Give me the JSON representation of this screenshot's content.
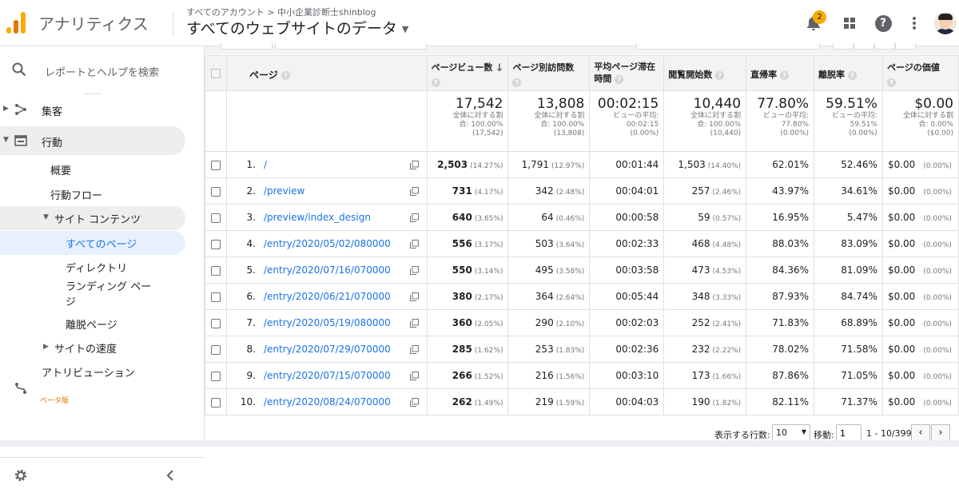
{
  "header": {
    "app_name": "アナリティクス",
    "breadcrumb": "すべてのアカウント > 中小企業診断士shinblog",
    "property_title": "すべてのウェブサイトのデータ",
    "notification_count": "2",
    "help_glyph": "?"
  },
  "sidebar": {
    "search_label": "レポートとヘルプを検索",
    "items": [
      {
        "label": "集客",
        "icon": "acquisition-icon"
      },
      {
        "label": "行動",
        "icon": "behavior-icon"
      },
      {
        "label": "概要"
      },
      {
        "label": "行動フロー"
      },
      {
        "label": "サイト コンテンツ"
      },
      {
        "label": "すべてのページ"
      },
      {
        "label": "ディレクトリ"
      },
      {
        "label": "ランディング ページ"
      },
      {
        "label": "離脱ページ"
      },
      {
        "label": "サイトの速度"
      },
      {
        "label": "アトリビューション",
        "icon": "attribution-icon"
      }
    ],
    "beta_label": "ベータ版"
  },
  "table": {
    "columns": {
      "page": "ページ",
      "pageviews": "ページビュー数",
      "unique": "ページ別訪問数",
      "avg_time": "平均ページ滞在時間",
      "entrances": "閲覧開始数",
      "bounce": "直帰率",
      "exit": "離脱率",
      "value": "ページの価値"
    },
    "totals": {
      "pageviews": {
        "value": "17,542",
        "sub1": "全体に対する割",
        "sub2": "合: 100.00%",
        "sub3": "(17,542)"
      },
      "unique": {
        "value": "13,808",
        "sub1": "全体に対する割",
        "sub2": "合: 100.00%",
        "sub3": "(13,808)"
      },
      "avg_time": {
        "value": "00:02:15",
        "sub1": "ビューの平均:",
        "sub2": "00:02:15",
        "sub3": "(0.00%)"
      },
      "entrances": {
        "value": "10,440",
        "sub1": "全体に対する割",
        "sub2": "合: 100.00%",
        "sub3": "(10,440)"
      },
      "bounce": {
        "value": "77.80%",
        "sub1": "ビューの平均:",
        "sub2": "77.80%",
        "sub3": "(0.00%)"
      },
      "exit": {
        "value": "59.51%",
        "sub1": "ビューの平均:",
        "sub2": "59.51%",
        "sub3": "(0.00%)"
      },
      "value": {
        "value": "$0.00",
        "sub1": "全体に対する割",
        "sub2": "合: 0.00%",
        "sub3": "($0.00)"
      }
    },
    "rows": [
      {
        "idx": "1.",
        "page": "/",
        "pv": "2,503",
        "pv_pct": "(14.27%)",
        "uv": "1,791",
        "uv_pct": "(12.97%)",
        "time": "00:01:44",
        "ent": "1,503",
        "ent_pct": "(14.40%)",
        "bounce": "62.01%",
        "exit": "52.46%",
        "val": "$0.00",
        "val_pct": "(0.00%)"
      },
      {
        "idx": "2.",
        "page": "/preview",
        "pv": "731",
        "pv_pct": "(4.17%)",
        "uv": "342",
        "uv_pct": "(2.48%)",
        "time": "00:04:01",
        "ent": "257",
        "ent_pct": "(2.46%)",
        "bounce": "43.97%",
        "exit": "34.61%",
        "val": "$0.00",
        "val_pct": "(0.00%)"
      },
      {
        "idx": "3.",
        "page": "/preview/index_design",
        "pv": "640",
        "pv_pct": "(3.65%)",
        "uv": "64",
        "uv_pct": "(0.46%)",
        "time": "00:00:58",
        "ent": "59",
        "ent_pct": "(0.57%)",
        "bounce": "16.95%",
        "exit": "5.47%",
        "val": "$0.00",
        "val_pct": "(0.00%)"
      },
      {
        "idx": "4.",
        "page": "/entry/2020/05/02/080000",
        "pv": "556",
        "pv_pct": "(3.17%)",
        "uv": "503",
        "uv_pct": "(3.64%)",
        "time": "00:02:33",
        "ent": "468",
        "ent_pct": "(4.48%)",
        "bounce": "88.03%",
        "exit": "83.09%",
        "val": "$0.00",
        "val_pct": "(0.00%)"
      },
      {
        "idx": "5.",
        "page": "/entry/2020/07/16/070000",
        "pv": "550",
        "pv_pct": "(3.14%)",
        "uv": "495",
        "uv_pct": "(3.58%)",
        "time": "00:03:58",
        "ent": "473",
        "ent_pct": "(4.53%)",
        "bounce": "84.36%",
        "exit": "81.09%",
        "val": "$0.00",
        "val_pct": "(0.00%)"
      },
      {
        "idx": "6.",
        "page": "/entry/2020/06/21/070000",
        "pv": "380",
        "pv_pct": "(2.17%)",
        "uv": "364",
        "uv_pct": "(2.64%)",
        "time": "00:05:44",
        "ent": "348",
        "ent_pct": "(3.33%)",
        "bounce": "87.93%",
        "exit": "84.74%",
        "val": "$0.00",
        "val_pct": "(0.00%)"
      },
      {
        "idx": "7.",
        "page": "/entry/2020/05/19/080000",
        "pv": "360",
        "pv_pct": "(2.05%)",
        "uv": "290",
        "uv_pct": "(2.10%)",
        "time": "00:02:03",
        "ent": "252",
        "ent_pct": "(2.41%)",
        "bounce": "71.83%",
        "exit": "68.89%",
        "val": "$0.00",
        "val_pct": "(0.00%)"
      },
      {
        "idx": "8.",
        "page": "/entry/2020/07/29/070000",
        "pv": "285",
        "pv_pct": "(1.62%)",
        "uv": "253",
        "uv_pct": "(1.83%)",
        "time": "00:02:36",
        "ent": "232",
        "ent_pct": "(2.22%)",
        "bounce": "78.02%",
        "exit": "71.58%",
        "val": "$0.00",
        "val_pct": "(0.00%)"
      },
      {
        "idx": "9.",
        "page": "/entry/2020/07/15/070000",
        "pv": "266",
        "pv_pct": "(1.52%)",
        "uv": "216",
        "uv_pct": "(1.56%)",
        "time": "00:03:10",
        "ent": "173",
        "ent_pct": "(1.66%)",
        "bounce": "87.86%",
        "exit": "71.05%",
        "val": "$0.00",
        "val_pct": "(0.00%)"
      },
      {
        "idx": "10.",
        "page": "/entry/2020/08/24/070000",
        "pv": "262",
        "pv_pct": "(1.49%)",
        "uv": "219",
        "uv_pct": "(1.59%)",
        "time": "00:04:03",
        "ent": "190",
        "ent_pct": "(1.82%)",
        "bounce": "82.11%",
        "exit": "71.37%",
        "val": "$0.00",
        "val_pct": "(0.00%)"
      }
    ]
  },
  "pagination": {
    "rows_label": "表示する行数:",
    "rows_value": "10",
    "goto_label": "移動:",
    "goto_value": "1",
    "range": "1 - 10/399",
    "prev": "‹",
    "next": "›"
  },
  "colors": {
    "accent": "#1a73e8",
    "logo": "#f9ab00",
    "badge": "#f9ab00",
    "beta": "#e37400"
  }
}
